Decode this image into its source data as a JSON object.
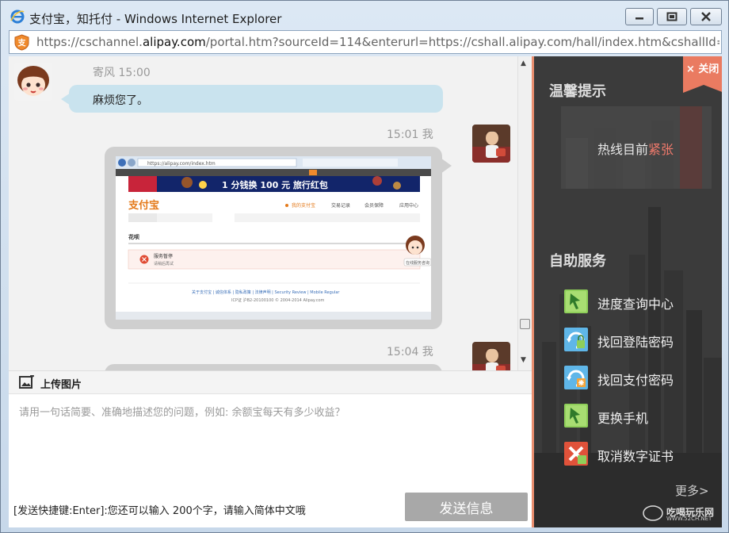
{
  "window": {
    "title": "支付宝，知托付 - Windows Internet Explorer",
    "url_prefix": "https://cschannel.",
    "url_domain": "alipay.com",
    "url_rest": "/portal.htm?sourceId=114&enterurl=https://cshall.alipay.com/hall/index.htm&cshallId=8e"
  },
  "chat": {
    "messages": [
      {
        "sender": "寄风",
        "time": "寄风 15:00",
        "text": "麻烦您了。"
      },
      {
        "sender": "我",
        "time": "15:01 我",
        "type": "image"
      },
      {
        "sender": "我",
        "time": "15:04 我",
        "type": "image"
      }
    ],
    "screenshot": {
      "url": "https://alipay.com/index.htm",
      "banner": "1 分钱换 100 元 旅行红包",
      "logo": "支付宝",
      "nav": [
        "我的支付宝",
        "交易记录",
        "会员保障",
        "应用中心"
      ],
      "section": "花呗",
      "error_title": "服务暂停",
      "error_sub": "请稍后再试",
      "help_label": "在线服务咨询",
      "footer_links": "关于支付宝 | 诚信体系 | 隐私政策 | 法律声明 | Security Review | Mobile Regular",
      "footer_copy": "ICP证 沪B2-20100100 © 2004-2014 Alipay.com"
    }
  },
  "upload": {
    "label": "上传图片"
  },
  "input": {
    "placeholder": "请用一句话简要、准确地描述您的问题，例如: 余额宝每天有多少收益？",
    "hint": "[发送快捷键:Enter]:您还可以输入 200个字，请输入简体中文哦",
    "send_label": "发送信息"
  },
  "side": {
    "close_label": "× 关闭",
    "tips_title": "温馨提示",
    "hotline_prefix": "热线目前",
    "hotline_status": "紧张",
    "service_title": "自助服务",
    "services": [
      {
        "label": "进度查询中心",
        "icon": "progress-query-icon"
      },
      {
        "label": "找回登陆密码",
        "icon": "login-password-icon"
      },
      {
        "label": "找回支付密码",
        "icon": "payment-password-icon"
      },
      {
        "label": "更换手机",
        "icon": "change-phone-icon"
      },
      {
        "label": "取消数字证书",
        "icon": "cancel-certificate-icon"
      }
    ],
    "more_label": "更多>",
    "watermark": "吃喝玩乐网",
    "watermark_sub": "WWW.52CH.NET"
  },
  "colors": {
    "accent": "#ea7b61",
    "bubble_left": "#c9e3ee",
    "bubble_right": "#cfcfcf",
    "panel": "#3a3a3a",
    "send_button": "#a8a8a8",
    "hotline_red": "#f07a6c"
  }
}
